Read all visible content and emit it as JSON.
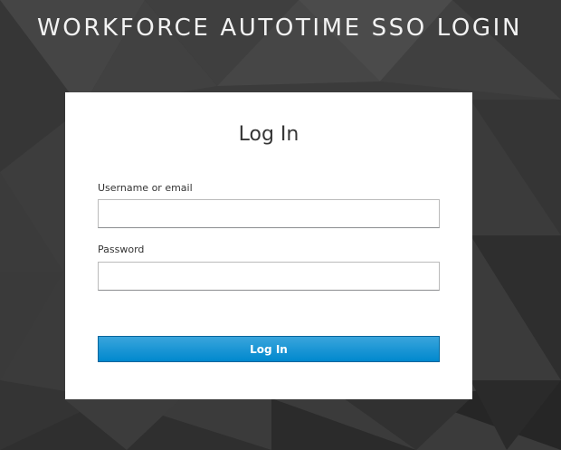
{
  "header": {
    "title": "WORKFORCE AUTOTIME SSO LOGIN"
  },
  "login_form": {
    "title": "Log In",
    "username_label": "Username or email",
    "username_value": "",
    "password_label": "Password",
    "password_value": "",
    "submit_label": "Log In"
  },
  "colors": {
    "background_dark": "#2e2e2e",
    "background_light": "#4a4a4a",
    "card_background": "#ffffff",
    "button_primary": "#0088ce",
    "button_primary_light": "#39a5dc",
    "header_text": "#f2f2f2"
  }
}
